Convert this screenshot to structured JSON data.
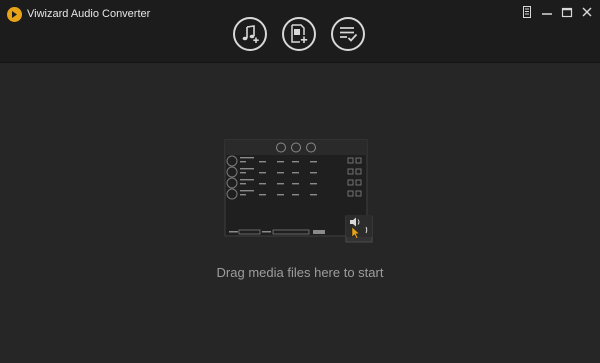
{
  "app": {
    "title": "Viwizard Audio Converter"
  },
  "window_controls": [
    {
      "name": "menu-icon"
    },
    {
      "name": "minimize-icon"
    },
    {
      "name": "maximize-icon"
    },
    {
      "name": "close-icon"
    }
  ],
  "toolbar": {
    "buttons": [
      {
        "name": "add-music-icon"
      },
      {
        "name": "add-file-icon"
      },
      {
        "name": "converted-list-icon"
      }
    ]
  },
  "drop_area": {
    "hint": "Drag media files here to start"
  },
  "colors": {
    "background": "#262626",
    "titlebar": "#1c1c1c",
    "accent": "#e8a317",
    "icon": "#d8d8d8",
    "hint_text": "#9d9d9d"
  }
}
